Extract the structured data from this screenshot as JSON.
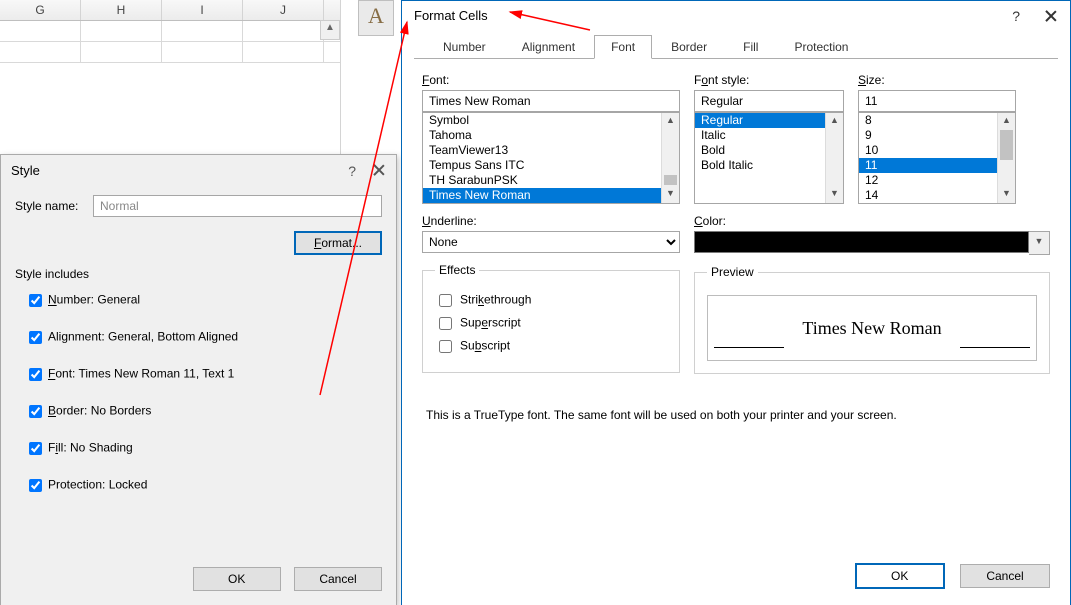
{
  "sheet": {
    "cols": [
      "G",
      "H",
      "I",
      "J"
    ]
  },
  "badge": "A",
  "style_dialog": {
    "title": "Style",
    "style_name_label": "Style name:",
    "style_name_value": "Normal",
    "format_btn": "Format...",
    "includes_label": "Style includes",
    "opts": {
      "number": "Number: General",
      "alignment": "Alignment: General, Bottom Aligned",
      "font": "Font: Times New Roman 11, Text 1",
      "border": "Border: No Borders",
      "fill": "Fill: No Shading",
      "protection": "Protection: Locked"
    },
    "ok": "OK",
    "cancel": "Cancel"
  },
  "format_cells": {
    "title": "Format Cells",
    "tabs": {
      "number": "Number",
      "alignment": "Alignment",
      "font": "Font",
      "border": "Border",
      "fill": "Fill",
      "protection": "Protection"
    },
    "font": {
      "font_label": "Font:",
      "font_value": "Times New Roman",
      "font_list": [
        "Symbol",
        "Tahoma",
        "TeamViewer13",
        "Tempus Sans ITC",
        "TH SarabunPSK",
        "Times New Roman"
      ],
      "style_label": "Font style:",
      "style_value": "Regular",
      "style_list": [
        "Regular",
        "Italic",
        "Bold",
        "Bold Italic"
      ],
      "size_label": "Size:",
      "size_value": "11",
      "size_list": [
        "8",
        "9",
        "10",
        "11",
        "12",
        "14"
      ],
      "underline_label": "Underline:",
      "underline_value": "None",
      "color_label": "Color:",
      "effects_label": "Effects",
      "fx": {
        "strike": "Strikethrough",
        "sup": "Superscript",
        "sub": "Subscript"
      },
      "preview_label": "Preview",
      "preview_text": "Times New Roman",
      "note": "This is a TrueType font.  The same font will be used on both your printer and your screen."
    },
    "ok": "OK",
    "cancel": "Cancel"
  }
}
